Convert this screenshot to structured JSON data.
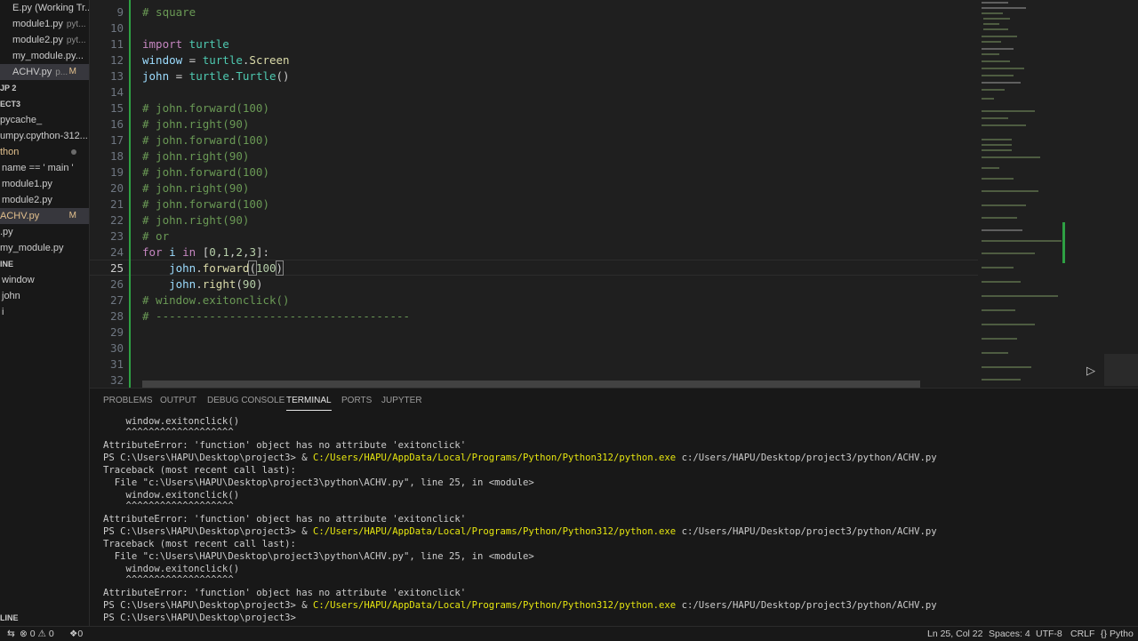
{
  "sidebar": {
    "items": [
      {
        "label": "E.py (Working Tr...",
        "desc": "",
        "badge": "",
        "top": 0
      },
      {
        "label": "module1.py",
        "desc": "pyt...",
        "badge": ""
      },
      {
        "label": "module2.py",
        "desc": "pyt...",
        "badge": ""
      },
      {
        "label": "my_module.py...",
        "desc": "",
        "badge": ""
      },
      {
        "label": "ACHV.py",
        "desc": "p...",
        "badge": "M"
      },
      {
        "label": "JP 2",
        "desc": "",
        "badge": ""
      },
      {
        "label": "ECT3",
        "desc": "",
        "badge": ""
      },
      {
        "label": "pycache_",
        "desc": "",
        "badge": ""
      },
      {
        "label": "umpy.cpython-312...",
        "desc": "",
        "badge": ""
      },
      {
        "label": "thon",
        "desc": "",
        "badge": ""
      },
      {
        "label": "name == ' main '",
        "desc": "",
        "badge": ""
      },
      {
        "label": "module1.py",
        "desc": "",
        "badge": ""
      },
      {
        "label": "module2.py",
        "desc": "",
        "badge": ""
      },
      {
        "label": "ACHV.py",
        "desc": "",
        "badge": "M"
      },
      {
        "label": ".py",
        "desc": "",
        "badge": ""
      },
      {
        "label": "my_module.py",
        "desc": "",
        "badge": ""
      },
      {
        "label": "INE",
        "desc": "",
        "badge": ""
      },
      {
        "label": "window",
        "desc": "",
        "badge": ""
      },
      {
        "label": "john",
        "desc": "",
        "badge": ""
      },
      {
        "label": "i",
        "desc": "",
        "badge": ""
      },
      {
        "label": "LINE",
        "desc": "",
        "badge": ""
      }
    ]
  },
  "editor": {
    "line_numbers": [
      "9",
      "10",
      "11",
      "12",
      "13",
      "14",
      "15",
      "16",
      "17",
      "18",
      "19",
      "20",
      "21",
      "22",
      "23",
      "24",
      "25",
      "26",
      "27",
      "28",
      "29",
      "30",
      "31",
      "32"
    ],
    "current_line": "25",
    "code": {
      "l9": "# square",
      "l11a": "import",
      "l11b": " turtle",
      "l12a": "window",
      "l12b": " = ",
      "l12c": "turtle",
      "l12d": ".",
      "l12e": "Screen",
      "l13a": "john",
      "l13b": " = ",
      "l13c": "turtle",
      "l13d": ".",
      "l13e": "Turtle",
      "l13f": "()",
      "l15": "# john.forward(100)",
      "l16": "# john.right(90)",
      "l17": "# john.forward(100)",
      "l18": "# john.right(90)",
      "l19": "# john.forward(100)",
      "l20": "# john.right(90)",
      "l21": "# john.forward(100)",
      "l22": "# john.right(90)",
      "l23": "# or",
      "l24a": "for",
      "l24b": " i ",
      "l24c": "in",
      "l24d": " [",
      "l24e": "0",
      "l24f": ",",
      "l24g": "1",
      "l24h": ",",
      "l24i": "2",
      "l24j": ",",
      "l24k": "3",
      "l24l": "]:",
      "l25a": "    john",
      "l25b": ".",
      "l25c": "forward",
      "l25d": "(",
      "l25e": "100",
      "l25f": ")",
      "l26a": "    john",
      "l26b": ".",
      "l26c": "right",
      "l26d": "(",
      "l26e": "90",
      "l26f": ")",
      "l27": "# window.exitonclick()",
      "l28": "# --------------------------------------"
    }
  },
  "panel": {
    "tabs": [
      "PROBLEMS",
      "OUTPUT",
      "DEBUG CONSOLE",
      "TERMINAL",
      "PORTS",
      "JUPYTER"
    ],
    "active_tab": "TERMINAL",
    "terminal": {
      "t1": "    window.exitonclick()",
      "t2": "    ^^^^^^^^^^^^^^^^^^^",
      "t3": "AttributeError: 'function' object has no attribute 'exitonclick'",
      "t4a": "PS C:\\Users\\HAPU\\Desktop\\project3> & ",
      "t4b": "C:/Users/HAPU/AppData/Local/Programs/Python/Python312/python.exe",
      "t4c": " c:/Users/HAPU/Desktop/project3/python/ACHV.py",
      "t5": "Traceback (most recent call last):",
      "t6": "  File \"c:\\Users\\HAPU\\Desktop\\project3\\python\\ACHV.py\", line 25, in <module>",
      "t7": "    window.exitonclick()",
      "t8": "    ^^^^^^^^^^^^^^^^^^^",
      "t9": "AttributeError: 'function' object has no attribute 'exitonclick'",
      "t10a": "PS C:\\Users\\HAPU\\Desktop\\project3> & ",
      "t10b": "C:/Users/HAPU/AppData/Local/Programs/Python/Python312/python.exe",
      "t10c": " c:/Users/HAPU/Desktop/project3/python/ACHV.py",
      "t11": "Traceback (most recent call last):",
      "t12": "  File \"c:\\Users\\HAPU\\Desktop\\project3\\python\\ACHV.py\", line 25, in <module>",
      "t13": "    window.exitonclick()",
      "t14": "    ^^^^^^^^^^^^^^^^^^^",
      "t15": "AttributeError: 'function' object has no attribute 'exitonclick'",
      "t16a": "PS C:\\Users\\HAPU\\Desktop\\project3> & ",
      "t16b": "C:/Users/HAPU/AppData/Local/Programs/Python/Python312/python.exe",
      "t16c": " c:/Users/HAPU/Desktop/project3/python/ACHV.py",
      "t17": "PS C:\\Users\\HAPU\\Desktop\\project3>"
    }
  },
  "status": {
    "errors": "0",
    "warnings": "0",
    "ports": "0",
    "cursor": "Ln 25, Col 22",
    "spaces": "Spaces: 4",
    "encoding": "UTF-8",
    "eol": "CRLF",
    "language": "Pytho"
  },
  "colors": {
    "keyword": "#c586c0",
    "comment": "#6a9955",
    "function": "#dcdcaa",
    "number": "#b5cea8",
    "terminal_path": "#e5e510"
  }
}
